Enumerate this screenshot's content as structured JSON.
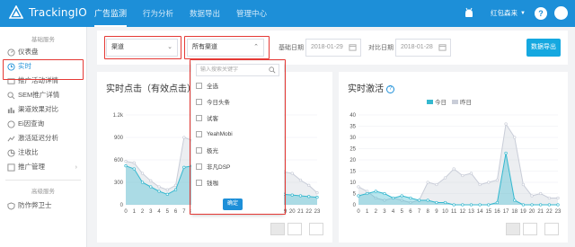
{
  "brand": {
    "name": "TrackingIO"
  },
  "nav": {
    "items": [
      "广告监测",
      "行为分析",
      "数据导出",
      "管理中心"
    ],
    "active": 0
  },
  "user": {
    "name": "红包森来"
  },
  "help": "?",
  "sidebar": {
    "group1": "基础服务",
    "items": [
      {
        "label": "仪表盘",
        "icon": "dashboard-icon"
      },
      {
        "label": "实时",
        "icon": "clock-icon"
      },
      {
        "label": "推广活动详情",
        "icon": "campaign-icon"
      },
      {
        "label": "SEM推广详情",
        "icon": "sem-icon"
      },
      {
        "label": "渠道效果对比",
        "icon": "compare-icon"
      },
      {
        "label": "Ei因查询",
        "icon": "query-icon"
      },
      {
        "label": "激活延迟分析",
        "icon": "delay-icon"
      },
      {
        "label": "注收比",
        "icon": "ratio-icon"
      },
      {
        "label": "推广管理",
        "icon": "manage-icon"
      }
    ],
    "group2": "高级服务",
    "advanced": [
      {
        "label": "防作弊卫士",
        "icon": "shield-icon"
      }
    ]
  },
  "filters": {
    "select1": "渠道",
    "select2": "所有渠道",
    "base_date_label": "基础日期",
    "base_date": "2018-01-29",
    "compare_date_label": "对比日期",
    "compare_date": "2018-01-28",
    "export": "数据导出"
  },
  "dropdown": {
    "search_placeholder": "输入搜索关键字",
    "options": [
      "全选",
      "今日头条",
      "试客",
      "YeahMobi",
      "极光",
      "非凡DSP",
      "钱咖"
    ],
    "ok": "确定"
  },
  "left_panel": {
    "title": "实时点击（有效点击）"
  },
  "right_panel": {
    "title": "实时激活",
    "legend": [
      "今日",
      "昨日"
    ]
  },
  "colors": {
    "primary": "#1d8fd8",
    "today": "#35b8cf",
    "yesterday": "#c9cdd8",
    "highlight": "#e53935"
  },
  "chart_data": [
    {
      "type": "area",
      "title": "实时点击（有效点击）",
      "categories": [
        "0",
        "1",
        "2",
        "3",
        "4",
        "5",
        "6",
        "7",
        "8",
        "9",
        "10",
        "11",
        "12",
        "13",
        "14",
        "15",
        "16",
        "17",
        "18",
        "19",
        "20",
        "21",
        "22",
        "23"
      ],
      "yticks": [
        "0",
        "300",
        "600",
        "900",
        "1.2k"
      ],
      "ylim": [
        0,
        1200
      ],
      "series": [
        {
          "name": "今日",
          "values": [
            520,
            480,
            300,
            240,
            180,
            140,
            200,
            500,
            520,
            440,
            380,
            300,
            260,
            240,
            220,
            200,
            180,
            160,
            150,
            140,
            130,
            120,
            110,
            100
          ]
        },
        {
          "name": "昨日",
          "values": [
            580,
            560,
            420,
            320,
            240,
            200,
            260,
            900,
            860,
            600,
            500,
            420,
            380,
            360,
            360,
            380,
            400,
            420,
            440,
            440,
            420,
            330,
            260,
            160
          ]
        }
      ]
    },
    {
      "type": "area",
      "title": "实时激活",
      "categories": [
        "0",
        "1",
        "2",
        "3",
        "4",
        "5",
        "6",
        "7",
        "8",
        "9",
        "10",
        "11",
        "12",
        "13",
        "14",
        "15",
        "16",
        "17",
        "18",
        "19",
        "20",
        "21",
        "22",
        "23"
      ],
      "yticks": [
        "0",
        "5",
        "10",
        "15",
        "20",
        "25",
        "30",
        "35",
        "40"
      ],
      "ylim": [
        0,
        40
      ],
      "series": [
        {
          "name": "今日",
          "values": [
            4,
            5,
            6,
            5,
            3,
            4,
            3,
            2,
            2,
            1,
            1,
            0,
            0,
            0,
            0,
            0,
            1,
            23,
            2,
            0,
            0,
            0,
            0,
            0
          ]
        },
        {
          "name": "昨日",
          "values": [
            8,
            6,
            3,
            2,
            3,
            2,
            1,
            2,
            10,
            9,
            12,
            16,
            13,
            14,
            9,
            10,
            11,
            36,
            30,
            9,
            4,
            5,
            3,
            3
          ]
        }
      ]
    }
  ]
}
